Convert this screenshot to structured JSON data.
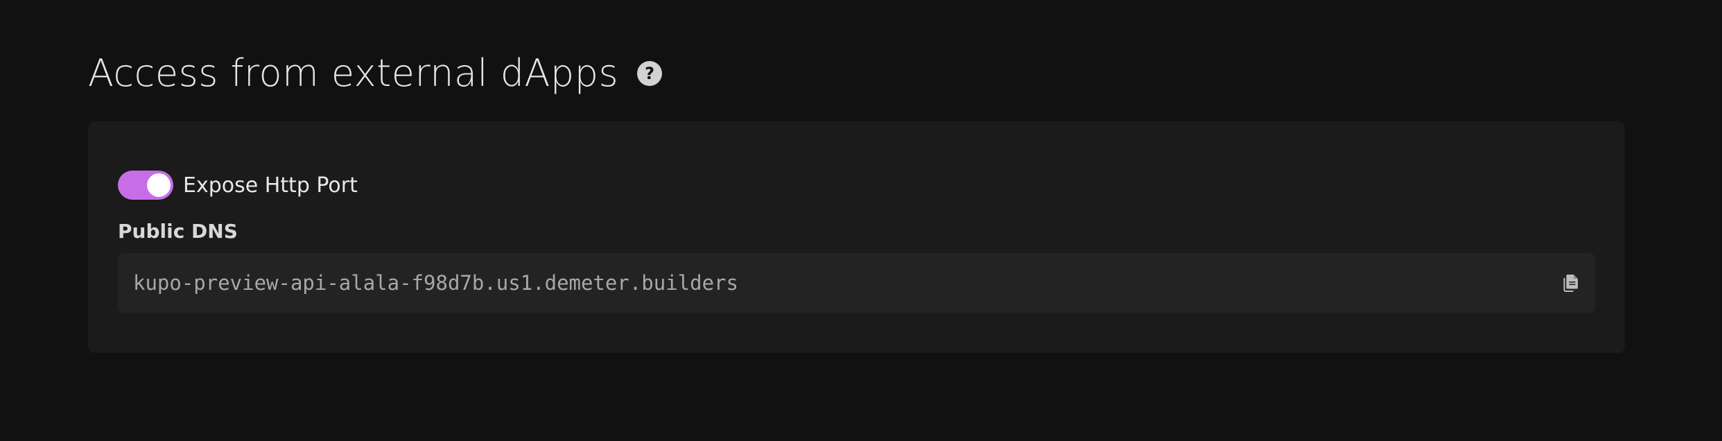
{
  "section": {
    "title": "Access from external dApps",
    "help_icon": "question-circle-icon"
  },
  "toggle": {
    "label": "Expose Http Port",
    "enabled": true,
    "accent_color": "#c76ee6"
  },
  "public_dns": {
    "label": "Public DNS",
    "value": "kupo-preview-api-alala-f98d7b.us1.demeter.builders",
    "copy_icon": "copy-icon"
  }
}
